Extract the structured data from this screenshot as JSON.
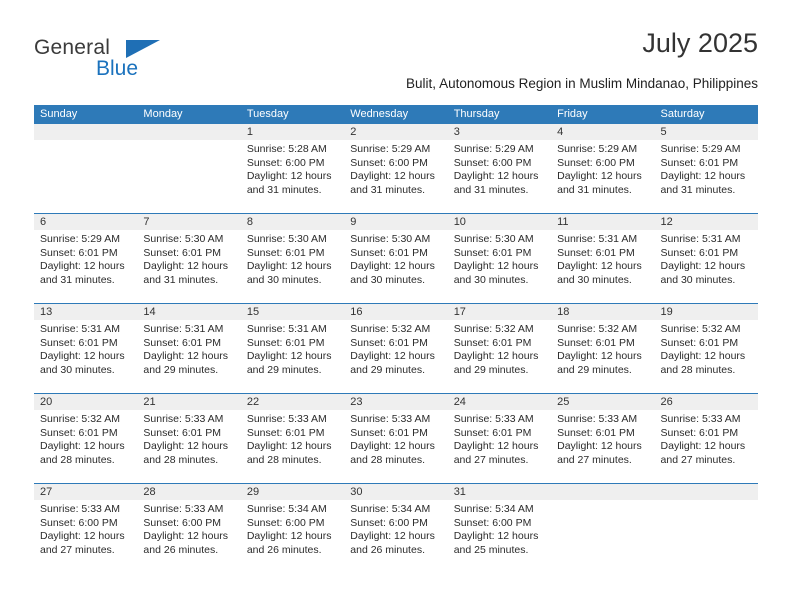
{
  "brand": {
    "name_part1": "General",
    "name_part2": "Blue",
    "triangle_icon": "triangle-icon",
    "colors": {
      "blue": "#1b72bd",
      "dark": "#3b3b3b"
    }
  },
  "header": {
    "title": "July 2025",
    "subtitle": "Bulit, Autonomous Region in Muslim Mindanao, Philippines"
  },
  "calendar": {
    "header_bg": "#2e7ab8",
    "daynum_bg": "#efefef",
    "weekdays": [
      "Sunday",
      "Monday",
      "Tuesday",
      "Wednesday",
      "Thursday",
      "Friday",
      "Saturday"
    ],
    "weeks": [
      [
        {
          "day": "",
          "sunrise": "",
          "sunset": "",
          "daylight": "",
          "empty": true
        },
        {
          "day": "",
          "sunrise": "",
          "sunset": "",
          "daylight": "",
          "empty": true
        },
        {
          "day": "1",
          "sunrise": "Sunrise: 5:28 AM",
          "sunset": "Sunset: 6:00 PM",
          "daylight": "Daylight: 12 hours and 31 minutes."
        },
        {
          "day": "2",
          "sunrise": "Sunrise: 5:29 AM",
          "sunset": "Sunset: 6:00 PM",
          "daylight": "Daylight: 12 hours and 31 minutes."
        },
        {
          "day": "3",
          "sunrise": "Sunrise: 5:29 AM",
          "sunset": "Sunset: 6:00 PM",
          "daylight": "Daylight: 12 hours and 31 minutes."
        },
        {
          "day": "4",
          "sunrise": "Sunrise: 5:29 AM",
          "sunset": "Sunset: 6:00 PM",
          "daylight": "Daylight: 12 hours and 31 minutes."
        },
        {
          "day": "5",
          "sunrise": "Sunrise: 5:29 AM",
          "sunset": "Sunset: 6:01 PM",
          "daylight": "Daylight: 12 hours and 31 minutes."
        }
      ],
      [
        {
          "day": "6",
          "sunrise": "Sunrise: 5:29 AM",
          "sunset": "Sunset: 6:01 PM",
          "daylight": "Daylight: 12 hours and 31 minutes."
        },
        {
          "day": "7",
          "sunrise": "Sunrise: 5:30 AM",
          "sunset": "Sunset: 6:01 PM",
          "daylight": "Daylight: 12 hours and 31 minutes."
        },
        {
          "day": "8",
          "sunrise": "Sunrise: 5:30 AM",
          "sunset": "Sunset: 6:01 PM",
          "daylight": "Daylight: 12 hours and 30 minutes."
        },
        {
          "day": "9",
          "sunrise": "Sunrise: 5:30 AM",
          "sunset": "Sunset: 6:01 PM",
          "daylight": "Daylight: 12 hours and 30 minutes."
        },
        {
          "day": "10",
          "sunrise": "Sunrise: 5:30 AM",
          "sunset": "Sunset: 6:01 PM",
          "daylight": "Daylight: 12 hours and 30 minutes."
        },
        {
          "day": "11",
          "sunrise": "Sunrise: 5:31 AM",
          "sunset": "Sunset: 6:01 PM",
          "daylight": "Daylight: 12 hours and 30 minutes."
        },
        {
          "day": "12",
          "sunrise": "Sunrise: 5:31 AM",
          "sunset": "Sunset: 6:01 PM",
          "daylight": "Daylight: 12 hours and 30 minutes."
        }
      ],
      [
        {
          "day": "13",
          "sunrise": "Sunrise: 5:31 AM",
          "sunset": "Sunset: 6:01 PM",
          "daylight": "Daylight: 12 hours and 30 minutes."
        },
        {
          "day": "14",
          "sunrise": "Sunrise: 5:31 AM",
          "sunset": "Sunset: 6:01 PM",
          "daylight": "Daylight: 12 hours and 29 minutes."
        },
        {
          "day": "15",
          "sunrise": "Sunrise: 5:31 AM",
          "sunset": "Sunset: 6:01 PM",
          "daylight": "Daylight: 12 hours and 29 minutes."
        },
        {
          "day": "16",
          "sunrise": "Sunrise: 5:32 AM",
          "sunset": "Sunset: 6:01 PM",
          "daylight": "Daylight: 12 hours and 29 minutes."
        },
        {
          "day": "17",
          "sunrise": "Sunrise: 5:32 AM",
          "sunset": "Sunset: 6:01 PM",
          "daylight": "Daylight: 12 hours and 29 minutes."
        },
        {
          "day": "18",
          "sunrise": "Sunrise: 5:32 AM",
          "sunset": "Sunset: 6:01 PM",
          "daylight": "Daylight: 12 hours and 29 minutes."
        },
        {
          "day": "19",
          "sunrise": "Sunrise: 5:32 AM",
          "sunset": "Sunset: 6:01 PM",
          "daylight": "Daylight: 12 hours and 28 minutes."
        }
      ],
      [
        {
          "day": "20",
          "sunrise": "Sunrise: 5:32 AM",
          "sunset": "Sunset: 6:01 PM",
          "daylight": "Daylight: 12 hours and 28 minutes."
        },
        {
          "day": "21",
          "sunrise": "Sunrise: 5:33 AM",
          "sunset": "Sunset: 6:01 PM",
          "daylight": "Daylight: 12 hours and 28 minutes."
        },
        {
          "day": "22",
          "sunrise": "Sunrise: 5:33 AM",
          "sunset": "Sunset: 6:01 PM",
          "daylight": "Daylight: 12 hours and 28 minutes."
        },
        {
          "day": "23",
          "sunrise": "Sunrise: 5:33 AM",
          "sunset": "Sunset: 6:01 PM",
          "daylight": "Daylight: 12 hours and 28 minutes."
        },
        {
          "day": "24",
          "sunrise": "Sunrise: 5:33 AM",
          "sunset": "Sunset: 6:01 PM",
          "daylight": "Daylight: 12 hours and 27 minutes."
        },
        {
          "day": "25",
          "sunrise": "Sunrise: 5:33 AM",
          "sunset": "Sunset: 6:01 PM",
          "daylight": "Daylight: 12 hours and 27 minutes."
        },
        {
          "day": "26",
          "sunrise": "Sunrise: 5:33 AM",
          "sunset": "Sunset: 6:01 PM",
          "daylight": "Daylight: 12 hours and 27 minutes."
        }
      ],
      [
        {
          "day": "27",
          "sunrise": "Sunrise: 5:33 AM",
          "sunset": "Sunset: 6:00 PM",
          "daylight": "Daylight: 12 hours and 27 minutes."
        },
        {
          "day": "28",
          "sunrise": "Sunrise: 5:33 AM",
          "sunset": "Sunset: 6:00 PM",
          "daylight": "Daylight: 12 hours and 26 minutes."
        },
        {
          "day": "29",
          "sunrise": "Sunrise: 5:34 AM",
          "sunset": "Sunset: 6:00 PM",
          "daylight": "Daylight: 12 hours and 26 minutes."
        },
        {
          "day": "30",
          "sunrise": "Sunrise: 5:34 AM",
          "sunset": "Sunset: 6:00 PM",
          "daylight": "Daylight: 12 hours and 26 minutes."
        },
        {
          "day": "31",
          "sunrise": "Sunrise: 5:34 AM",
          "sunset": "Sunset: 6:00 PM",
          "daylight": "Daylight: 12 hours and 25 minutes."
        },
        {
          "day": "",
          "sunrise": "",
          "sunset": "",
          "daylight": "",
          "empty": true
        },
        {
          "day": "",
          "sunrise": "",
          "sunset": "",
          "daylight": "",
          "empty": true
        }
      ]
    ]
  }
}
